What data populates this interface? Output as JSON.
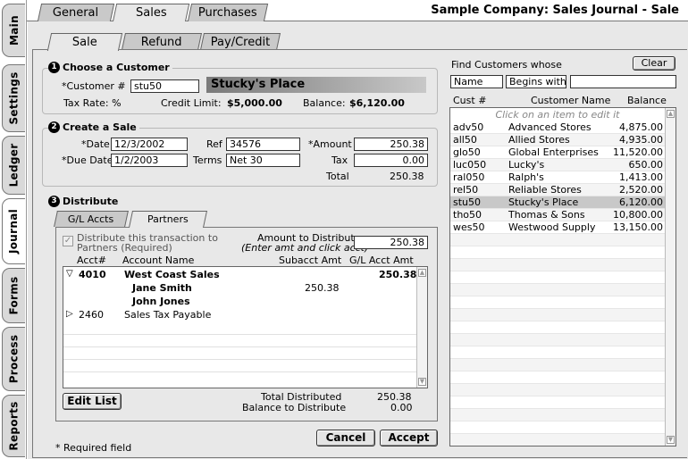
{
  "app": {
    "title": "Sample Company: Sales Journal - Sale"
  },
  "side_tabs": [
    "Main",
    "Settings",
    "Ledger",
    "Journal",
    "Forms",
    "Process",
    "Reports"
  ],
  "top_tabs": [
    "General",
    "Sales",
    "Purchases"
  ],
  "sub_tabs": [
    "Sale",
    "Refund",
    "Pay/Credit"
  ],
  "customer": {
    "section_title": "Choose a Customer",
    "customer_label": "*Customer #",
    "customer_value": "stu50",
    "customer_name": "Stucky's Place",
    "tax_rate_label": "Tax Rate: %",
    "credit_limit_label": "Credit Limit:",
    "credit_limit_value": "$5,000.00",
    "balance_label": "Balance:",
    "balance_value": "$6,120.00"
  },
  "sale": {
    "section_title": "Create a Sale",
    "date_label": "*Date",
    "date_value": "12/3/2002",
    "ref_label": "Ref",
    "ref_value": "34576",
    "amount_label": "*Amount",
    "amount_value": "250.38",
    "due_date_label": "*Due Date",
    "due_date_value": "1/2/2003",
    "terms_label": "Terms",
    "terms_value": "Net 30",
    "tax_label": "Tax",
    "tax_value": "0.00",
    "total_label": "Total",
    "total_value": "250.38"
  },
  "distribute": {
    "section_title": "Distribute",
    "tabs": [
      "G/L Accts",
      "Partners"
    ],
    "checkbox_label_1": "Distribute this transaction to",
    "checkbox_label_2": "Partners (Required)",
    "amount_to_distribute_label": "Amount to Distribute",
    "amount_hint": "(Enter amt and click acct)",
    "amount_to_distribute_value": "250.38",
    "columns": {
      "acct": "Acct#",
      "name": "Account Name",
      "subacct": "Subacct Amt",
      "gl": "G/L Acct Amt"
    },
    "rows": [
      {
        "acct": "4010",
        "name": "West Coast Sales",
        "subacct": "",
        "gl": "250.38"
      },
      {
        "acct": "",
        "name": "Jane Smith",
        "subacct": "250.38",
        "gl": ""
      },
      {
        "acct": "",
        "name": "John Jones",
        "subacct": "",
        "gl": ""
      },
      {
        "acct": "2460",
        "name": "Sales Tax Payable",
        "subacct": "",
        "gl": ""
      }
    ],
    "edit_list_label": "Edit List",
    "total_distributed_label": "Total Distributed",
    "total_distributed_value": "250.38",
    "balance_to_distribute_label": "Balance to Distribute",
    "balance_to_distribute_value": "0.00"
  },
  "required_note": "* Required field",
  "buttons": {
    "cancel": "Cancel",
    "accept": "Accept"
  },
  "find": {
    "label": "Find Customers whose",
    "clear_label": "Clear",
    "field_select": "Name",
    "match_select": "Begins with",
    "search_value": "",
    "columns": {
      "cust": "Cust #",
      "name": "Customer Name",
      "balance": "Balance"
    },
    "hint": "Click on an item to edit it",
    "customers": [
      {
        "cust": "adv50",
        "name": "Advanced Stores",
        "balance": "4,875.00"
      },
      {
        "cust": "all50",
        "name": "Allied Stores",
        "balance": "4,935.00"
      },
      {
        "cust": "glo50",
        "name": "Global Enterprises",
        "balance": "11,520.00"
      },
      {
        "cust": "luc050",
        "name": "Lucky's",
        "balance": "650.00"
      },
      {
        "cust": "ral050",
        "name": "Ralph's",
        "balance": "1,413.00"
      },
      {
        "cust": "rel50",
        "name": "Reliable Stores",
        "balance": "2,520.00"
      },
      {
        "cust": "stu50",
        "name": "Stucky's Place",
        "balance": "6,120.00"
      },
      {
        "cust": "tho50",
        "name": "Thomas & Sons",
        "balance": "10,800.00"
      },
      {
        "cust": "wes50",
        "name": "Westwood Supply",
        "balance": "13,150.00"
      }
    ]
  }
}
